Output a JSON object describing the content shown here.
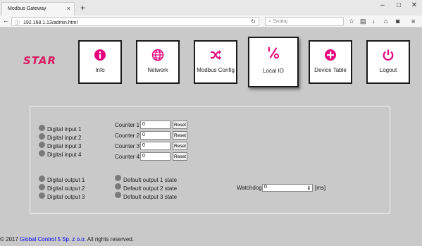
{
  "browser": {
    "tab_title": "Modbus Gateway",
    "tab_close": "×",
    "new_tab": "+",
    "win_minimize": "–",
    "win_maximize": "□",
    "win_close": "✕",
    "url": "192.168.1.13/admin.html",
    "search_placeholder": "Szukaj"
  },
  "logo_text": "STAR",
  "nav": [
    {
      "label": "Info",
      "icon": "info-icon"
    },
    {
      "label": "Network",
      "icon": "globe-icon"
    },
    {
      "label": "Modbus Config",
      "icon": "shuffle-icon"
    },
    {
      "label": "Local IO",
      "icon": "percent-icon"
    },
    {
      "label": "Device Table",
      "icon": "plus-circle-icon"
    },
    {
      "label": "Logout",
      "icon": "power-icon"
    }
  ],
  "digital_inputs": [
    "Digital input 1",
    "Digital input 2",
    "Digital input 3",
    "Digital input 4"
  ],
  "counters": [
    {
      "label": "Counter 1",
      "value": "0"
    },
    {
      "label": "Counter 2",
      "value": "0"
    },
    {
      "label": "Counter 3",
      "value": "0"
    },
    {
      "label": "Counter 4",
      "value": "0"
    }
  ],
  "reset_label": "Reset",
  "digital_outputs": [
    "Digital output 1",
    "Digital output 2",
    "Digital output 3"
  ],
  "default_outputs": [
    "Default output 1 state",
    "Default output 2 state",
    "Default output 3 state"
  ],
  "watchdog": {
    "label": "Watchdog",
    "value": "0",
    "unit": "[ms]"
  },
  "footer": {
    "prefix": "© 2017 ",
    "company": "Global Control 5 Sp. z o.o.",
    "suffix": " All rights reserved."
  },
  "colors": {
    "accent": "#e6007e",
    "led_off": "#7a7a7a",
    "page_bg": "#c9c9c9"
  }
}
